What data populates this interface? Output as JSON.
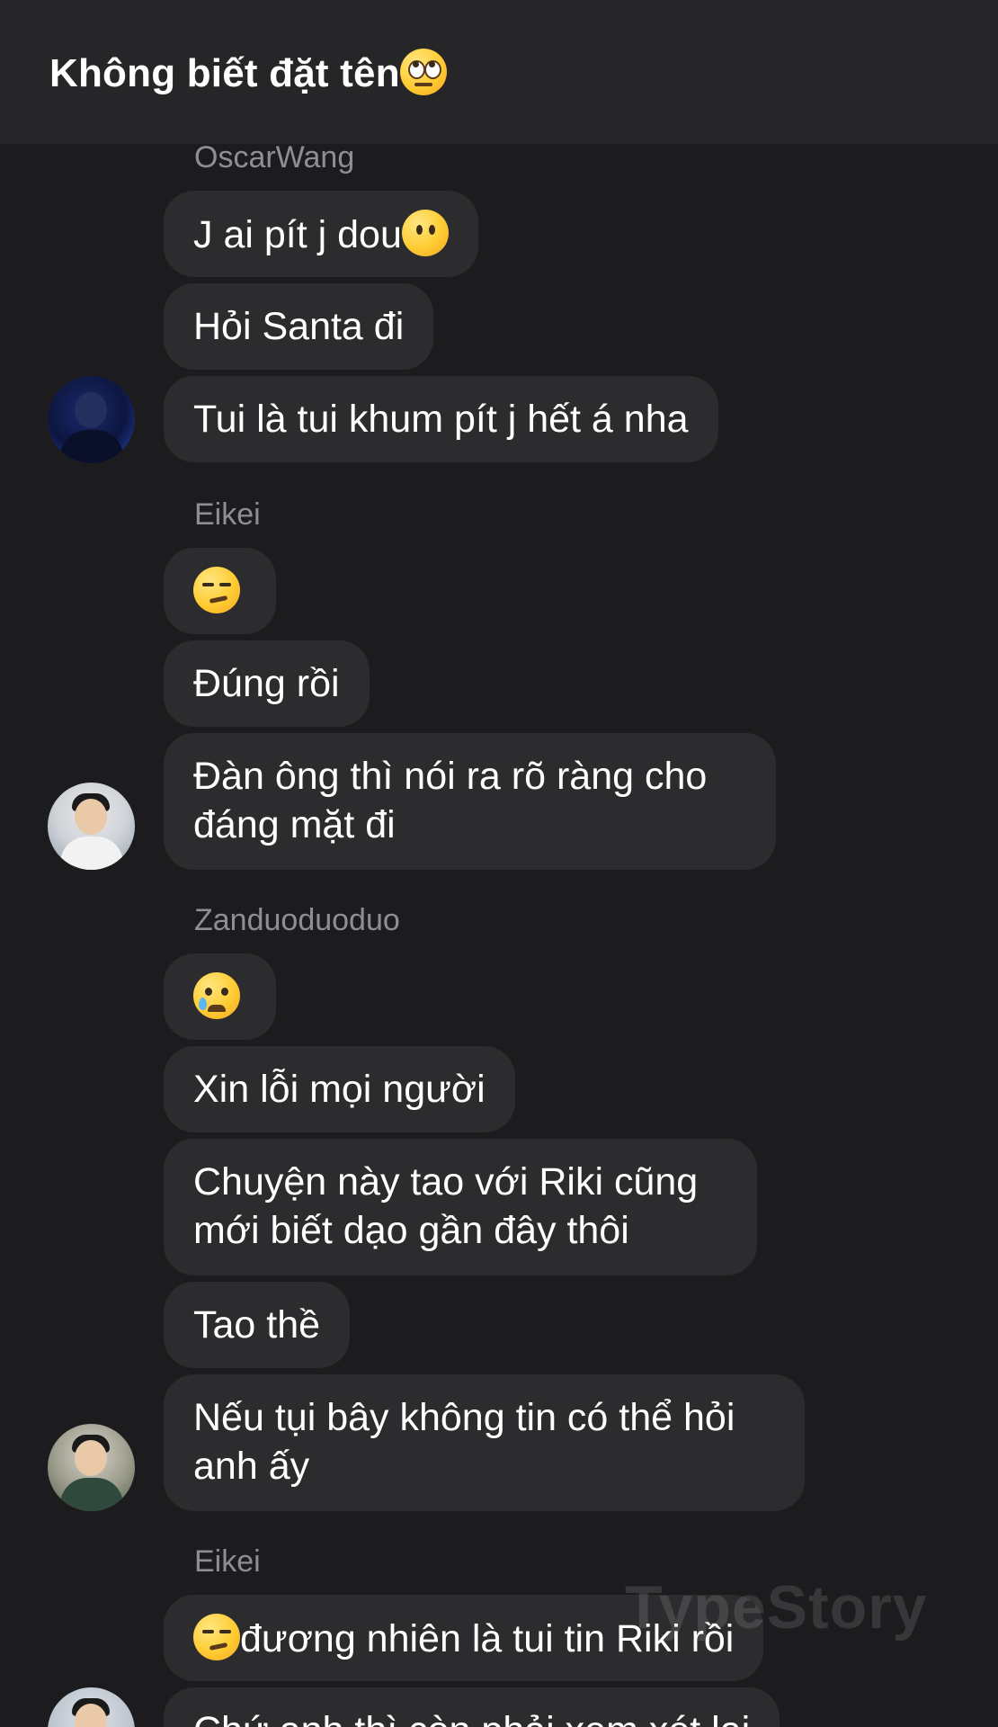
{
  "header": {
    "title": "Không biết đặt tên",
    "title_emoji": "face-with-rolling-eyes-emoji"
  },
  "messages": [
    {
      "sender": "OscarWang"
    },
    {
      "text": "J ai pít j dou",
      "emoji": "face-without-mouth-emoji"
    },
    {
      "text": "Hỏi Santa đi"
    },
    {
      "text": "Tui là tui khum pít j hết á nha"
    },
    {
      "sender": "Eikei"
    },
    {
      "emoji": "smirking-face-emoji"
    },
    {
      "text": "Đúng rồi"
    },
    {
      "text": "Đàn ông thì nói ra rõ ràng cho đáng mặt đi"
    },
    {
      "sender": "Zanduoduoduo"
    },
    {
      "emoji": "crying-face-emoji"
    },
    {
      "text": "Xin lỗi mọi người"
    },
    {
      "text": "Chuyện này tao với Riki cũng mới biết dạo gần đây thôi"
    },
    {
      "text": "Tao thề"
    },
    {
      "text": "Nếu tụi bây không tin có thể hỏi anh ấy"
    },
    {
      "sender": "Eikei"
    },
    {
      "text": "đương nhiên là tui tin Riki rồi",
      "emoji": "smirking-face-emoji"
    },
    {
      "text": "Chứ anh thì còn phải xem xét lại"
    }
  ],
  "watermark": "TypeStory",
  "colors": {
    "background": "#1c1c1e",
    "header": "#262628",
    "bubble": "#2c2c2e",
    "sender_name": "#8e8e93",
    "text": "#ffffff"
  }
}
